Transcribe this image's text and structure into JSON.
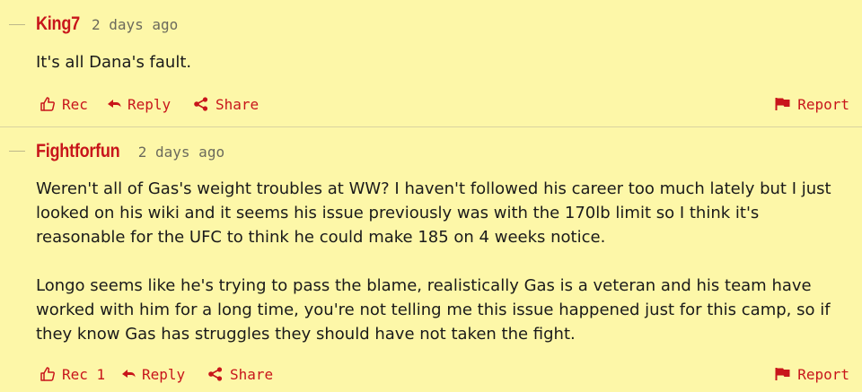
{
  "comments": [
    {
      "author": "King7",
      "time": "2 days ago",
      "paragraphs": [
        "It's all Dana's fault."
      ],
      "actions": {
        "rec": "Rec",
        "reply": "Reply",
        "share": "Share",
        "report": "Report"
      }
    },
    {
      "author": "Fightforfun",
      "time": "2 days ago",
      "paragraphs": [
        "Weren't all of Gas's weight troubles at WW? I haven't followed his career too much lately but I just looked on his wiki and it seems his issue previously was with the 170lb limit so I think it's reasonable for the UFC to think he could make 185 on 4 weeks notice.",
        "Longo seems like he's trying to pass the blame, realistically Gas is a veteran and his team have worked with him for a long time, you're not telling me this issue happened just for this camp, so if they know Gas has struggles they should have not taken the fight."
      ],
      "actions": {
        "rec": "Rec 1",
        "reply": "Reply",
        "share": "Share",
        "report": "Report"
      }
    }
  ],
  "colors": {
    "accent": "#c8151b",
    "background": "#fdf7a8",
    "timestamp": "#6b6a5c"
  },
  "icons": {
    "rec": "thumbs-up-icon",
    "reply": "reply-arrow-icon",
    "share": "share-icon",
    "report": "flag-icon"
  }
}
